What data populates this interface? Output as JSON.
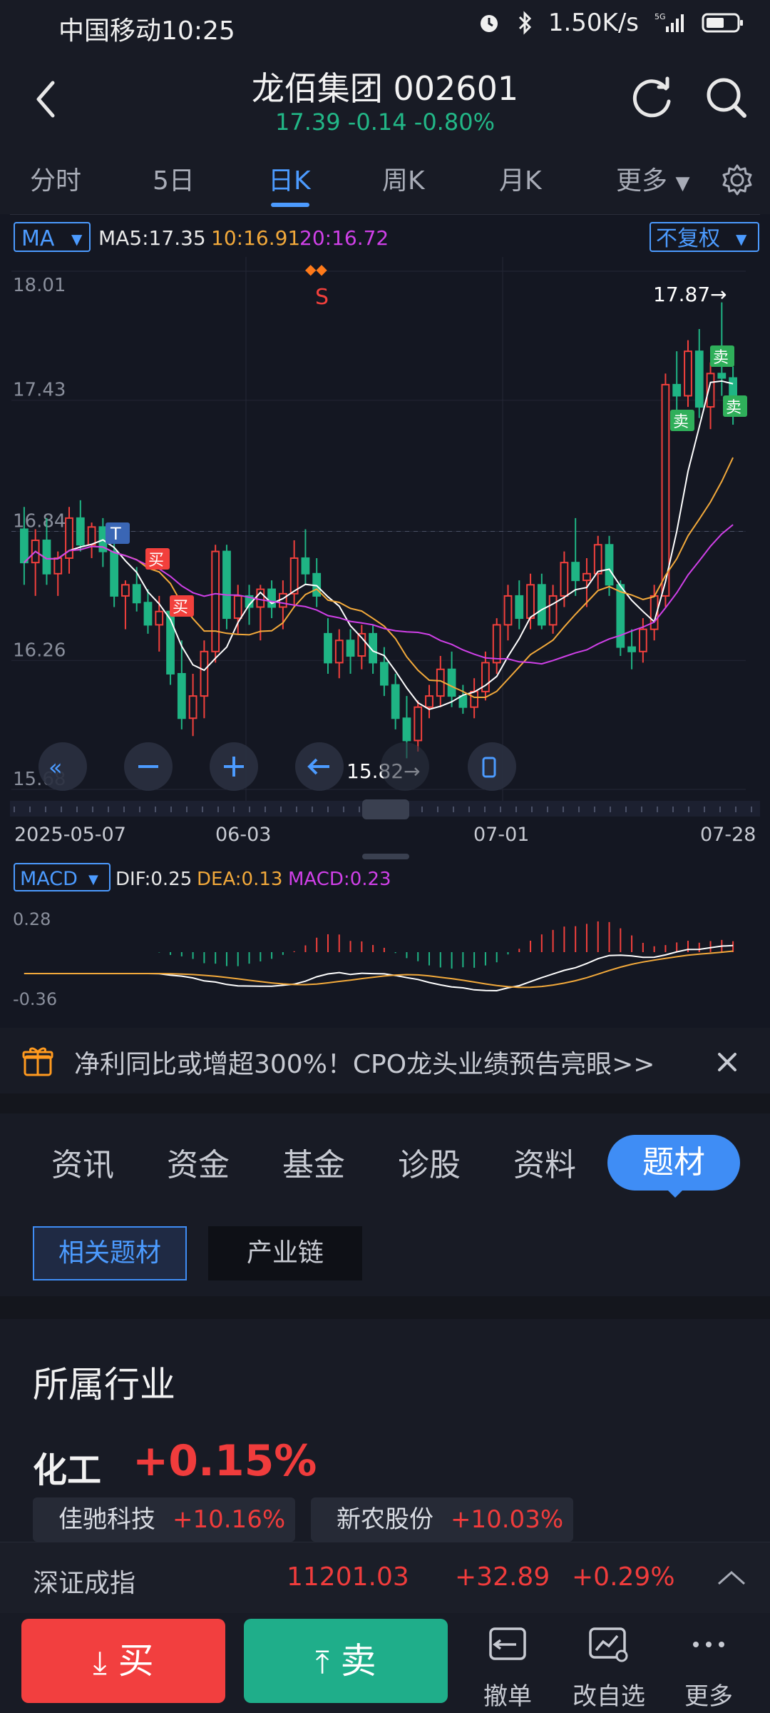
{
  "status_bar": {
    "carrier": "中国移动",
    "time": "10:25",
    "speed": "1.50K/s",
    "icons": [
      "alarm-icon",
      "bluetooth-icon",
      "5g-signal-icon",
      "battery-icon"
    ]
  },
  "header": {
    "title": "龙佰集团 002601",
    "quote": "17.39 -0.14 -0.80%",
    "quote_color": "#22b787"
  },
  "period_tabs": [
    "分时",
    "5日",
    "日K",
    "周K",
    "月K",
    "更多"
  ],
  "active_tab": "日K",
  "chart": {
    "ma_button": "MA",
    "ma5": "MA5:17.35",
    "ma10": "10:16.91",
    "ma20": "20:16.72",
    "adjust_button": "不复权",
    "max_label": "17.87→",
    "min_label": "15.82→",
    "s_marker": "S",
    "t_marker": "T",
    "buy_label": "买",
    "sell_label": "卖",
    "macd_button": "MACD",
    "dif": "DIF:0.25",
    "dea": "DEA:0.13",
    "macd": "MACD:0.23",
    "colors": {
      "up": "#f2403c",
      "down": "#1fb484",
      "ma5": "#ffffff",
      "ma10": "#f2a93b",
      "ma20": "#d040e8"
    }
  },
  "chart_data": {
    "type": "candlestick",
    "y_ticks": [
      "18.01",
      "17.43",
      "16.84",
      "16.26",
      "15.68"
    ],
    "x_ticks": [
      "2025-05-07",
      "06-03",
      "07-01",
      "07-28"
    ],
    "ylim": [
      15.68,
      18.01
    ],
    "ohlc": [
      [
        16.85,
        16.95,
        16.6,
        16.7
      ],
      [
        16.7,
        16.85,
        16.55,
        16.8
      ],
      [
        16.8,
        16.9,
        16.6,
        16.65
      ],
      [
        16.65,
        16.75,
        16.55,
        16.72
      ],
      [
        16.72,
        16.95,
        16.65,
        16.9
      ],
      [
        16.9,
        16.98,
        16.75,
        16.78
      ],
      [
        16.78,
        16.88,
        16.72,
        16.86
      ],
      [
        16.86,
        16.9,
        16.68,
        16.75
      ],
      [
        16.75,
        16.8,
        16.5,
        16.55
      ],
      [
        16.55,
        16.62,
        16.4,
        16.6
      ],
      [
        16.6,
        16.68,
        16.48,
        16.52
      ],
      [
        16.52,
        16.58,
        16.38,
        16.42
      ],
      [
        16.42,
        16.55,
        16.3,
        16.48
      ],
      [
        16.48,
        16.5,
        16.15,
        16.2
      ],
      [
        16.2,
        16.35,
        15.95,
        16.0
      ],
      [
        16.0,
        16.2,
        15.92,
        16.1
      ],
      [
        16.1,
        16.35,
        16.0,
        16.3
      ],
      [
        16.3,
        16.78,
        16.25,
        16.75
      ],
      [
        16.75,
        16.78,
        16.4,
        16.45
      ],
      [
        16.45,
        16.6,
        16.38,
        16.55
      ],
      [
        16.55,
        16.6,
        16.42,
        16.5
      ],
      [
        16.5,
        16.6,
        16.35,
        16.58
      ],
      [
        16.58,
        16.62,
        16.45,
        16.5
      ],
      [
        16.5,
        16.62,
        16.4,
        16.56
      ],
      [
        16.56,
        16.8,
        16.5,
        16.72
      ],
      [
        16.72,
        16.85,
        16.6,
        16.65
      ],
      [
        16.65,
        16.72,
        16.5,
        16.55
      ],
      [
        16.38,
        16.45,
        16.2,
        16.25
      ],
      [
        16.25,
        16.4,
        16.18,
        16.35
      ],
      [
        16.35,
        16.4,
        16.2,
        16.28
      ],
      [
        16.28,
        16.42,
        16.22,
        16.38
      ],
      [
        16.38,
        16.42,
        16.2,
        16.25
      ],
      [
        16.25,
        16.32,
        16.1,
        16.15
      ],
      [
        16.15,
        16.2,
        15.95,
        16.0
      ],
      [
        16.0,
        16.1,
        15.82,
        15.9
      ],
      [
        15.9,
        16.08,
        15.85,
        16.05
      ],
      [
        16.05,
        16.15,
        16.0,
        16.1
      ],
      [
        16.1,
        16.28,
        16.05,
        16.22
      ],
      [
        16.22,
        16.3,
        16.05,
        16.1
      ],
      [
        16.1,
        16.15,
        16.02,
        16.05
      ],
      [
        16.05,
        16.18,
        16.0,
        16.12
      ],
      [
        16.12,
        16.3,
        16.08,
        16.25
      ],
      [
        16.25,
        16.45,
        16.2,
        16.42
      ],
      [
        16.42,
        16.6,
        16.35,
        16.55
      ],
      [
        16.55,
        16.62,
        16.4,
        16.45
      ],
      [
        16.45,
        16.65,
        16.4,
        16.6
      ],
      [
        16.6,
        16.65,
        16.4,
        16.42
      ],
      [
        16.42,
        16.6,
        16.38,
        16.55
      ],
      [
        16.55,
        16.75,
        16.5,
        16.7
      ],
      [
        16.7,
        16.9,
        16.55,
        16.62
      ],
      [
        16.62,
        16.72,
        16.5,
        16.65
      ],
      [
        16.65,
        16.82,
        16.58,
        16.78
      ],
      [
        16.78,
        16.82,
        16.55,
        16.6
      ],
      [
        16.6,
        16.62,
        16.28,
        16.32
      ],
      [
        16.32,
        16.4,
        16.22,
        16.3
      ],
      [
        16.3,
        16.45,
        16.25,
        16.4
      ],
      [
        16.4,
        16.6,
        16.35,
        16.55
      ],
      [
        16.55,
        17.55,
        16.5,
        17.5
      ],
      [
        17.5,
        17.65,
        17.3,
        17.45
      ],
      [
        17.45,
        17.7,
        17.4,
        17.65
      ],
      [
        17.65,
        17.75,
        17.35,
        17.4
      ],
      [
        17.4,
        17.6,
        17.3,
        17.55
      ],
      [
        17.55,
        17.87,
        17.45,
        17.53
      ],
      [
        17.53,
        17.58,
        17.32,
        17.39
      ]
    ]
  },
  "notice": {
    "text": "净利同比或增超300%！CPO龙头业绩预告亮眼>>"
  },
  "section_tabs": [
    "资讯",
    "资金",
    "基金",
    "诊股",
    "资料",
    "题材"
  ],
  "active_section": "题材",
  "subtabs": [
    "相关题材",
    "产业链"
  ],
  "industry": {
    "heading": "所属行业",
    "name": "化工",
    "pct": "+0.15%",
    "stocks": [
      {
        "name": "佳驰科技",
        "pct": "+10.16%"
      },
      {
        "name": "新农股份",
        "pct": "+10.03%"
      }
    ]
  },
  "index_bar": {
    "name": "深证成指",
    "value": "11201.03",
    "change": "+32.89",
    "pct": "+0.29%"
  },
  "bottom": {
    "buy": "买",
    "sell": "卖",
    "items": [
      "撤单",
      "改自选",
      "更多"
    ]
  }
}
